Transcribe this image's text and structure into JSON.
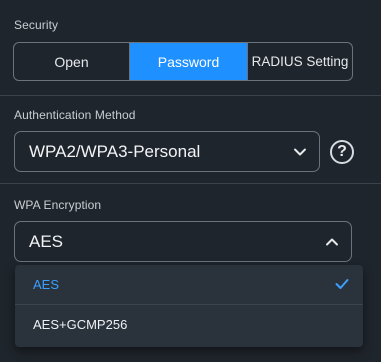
{
  "security": {
    "label": "Security",
    "options": [
      "Open",
      "Password",
      "RADIUS Setting"
    ],
    "selected": "Password"
  },
  "auth_method": {
    "label": "Authentication Method",
    "value": "WPA2/WPA3-Personal",
    "help_symbol": "?"
  },
  "wpa_encryption": {
    "label": "WPA Encryption",
    "value": "AES",
    "options": [
      "AES",
      "AES+GCMP256"
    ],
    "selected": "AES"
  },
  "colors": {
    "accent": "#1e90ff",
    "background": "#1f252c",
    "dropdown_bg": "#2a323b",
    "selected_option": "#3aa0ff"
  },
  "icons": {
    "auth_chevron": "chevron-down-icon",
    "wpa_chevron": "chevron-up-icon",
    "help": "help-circle-icon",
    "selected_mark": "check-icon"
  }
}
